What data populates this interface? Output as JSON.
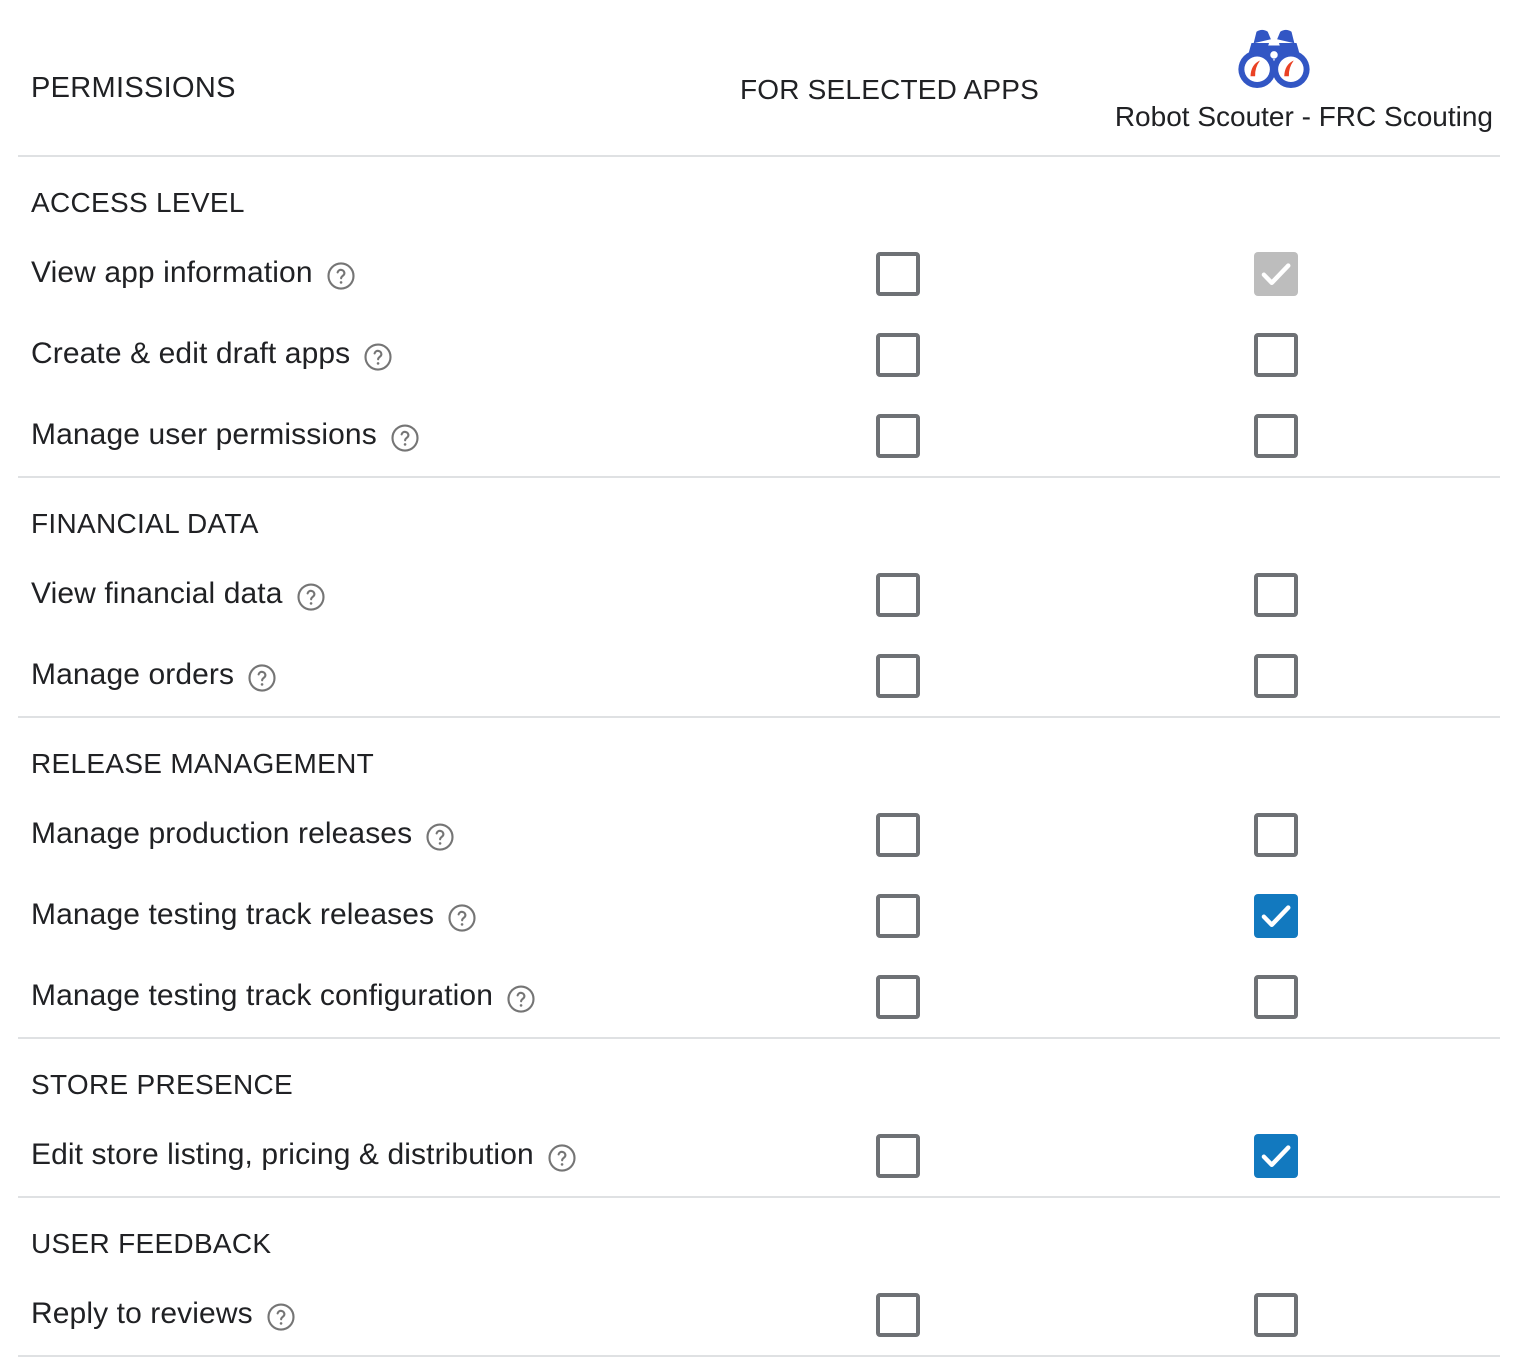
{
  "header": {
    "permissions_label": "PERMISSIONS",
    "for_selected_apps_label": "FOR SELECTED APPS",
    "app_name": "Robot Scouter - FRC Scouting",
    "app_icon": "binoculars-icon"
  },
  "colors": {
    "checked": "#1279bf",
    "checked_disabled": "#bdbdbd",
    "checkbox_border": "#6e7175",
    "divider": "#dfe1e3",
    "text": "#202124",
    "app_icon_blue": "#3256c4",
    "app_icon_accent": "#ea4124"
  },
  "help_icon_name": "help-circle-icon",
  "sections": [
    {
      "title": "ACCESS LEVEL",
      "rows": [
        {
          "label": "View app information",
          "help": "help-circle-icon",
          "for_selected_apps": "unchecked",
          "for_app": "checked-disabled"
        },
        {
          "label": "Create & edit draft apps",
          "help": "help-circle-icon",
          "for_selected_apps": "unchecked",
          "for_app": "unchecked"
        },
        {
          "label": "Manage user permissions",
          "help": "help-circle-icon",
          "for_selected_apps": "unchecked",
          "for_app": "unchecked"
        }
      ]
    },
    {
      "title": "FINANCIAL DATA",
      "rows": [
        {
          "label": "View financial data",
          "help": "help-circle-icon",
          "for_selected_apps": "unchecked",
          "for_app": "unchecked"
        },
        {
          "label": "Manage orders",
          "help": "help-circle-icon",
          "for_selected_apps": "unchecked",
          "for_app": "unchecked"
        }
      ]
    },
    {
      "title": "RELEASE MANAGEMENT",
      "rows": [
        {
          "label": "Manage production releases",
          "help": "help-circle-icon",
          "for_selected_apps": "unchecked",
          "for_app": "unchecked"
        },
        {
          "label": "Manage testing track releases",
          "help": "help-circle-icon",
          "for_selected_apps": "unchecked",
          "for_app": "checked"
        },
        {
          "label": "Manage testing track configuration",
          "help": "help-circle-icon",
          "for_selected_apps": "unchecked",
          "for_app": "unchecked"
        }
      ]
    },
    {
      "title": "STORE PRESENCE",
      "rows": [
        {
          "label": "Edit store listing, pricing & distribution",
          "help": "help-circle-icon",
          "for_selected_apps": "unchecked",
          "for_app": "checked"
        }
      ]
    },
    {
      "title": "USER FEEDBACK",
      "rows": [
        {
          "label": "Reply to reviews",
          "help": "help-circle-icon",
          "for_selected_apps": "unchecked",
          "for_app": "unchecked"
        }
      ]
    }
  ]
}
